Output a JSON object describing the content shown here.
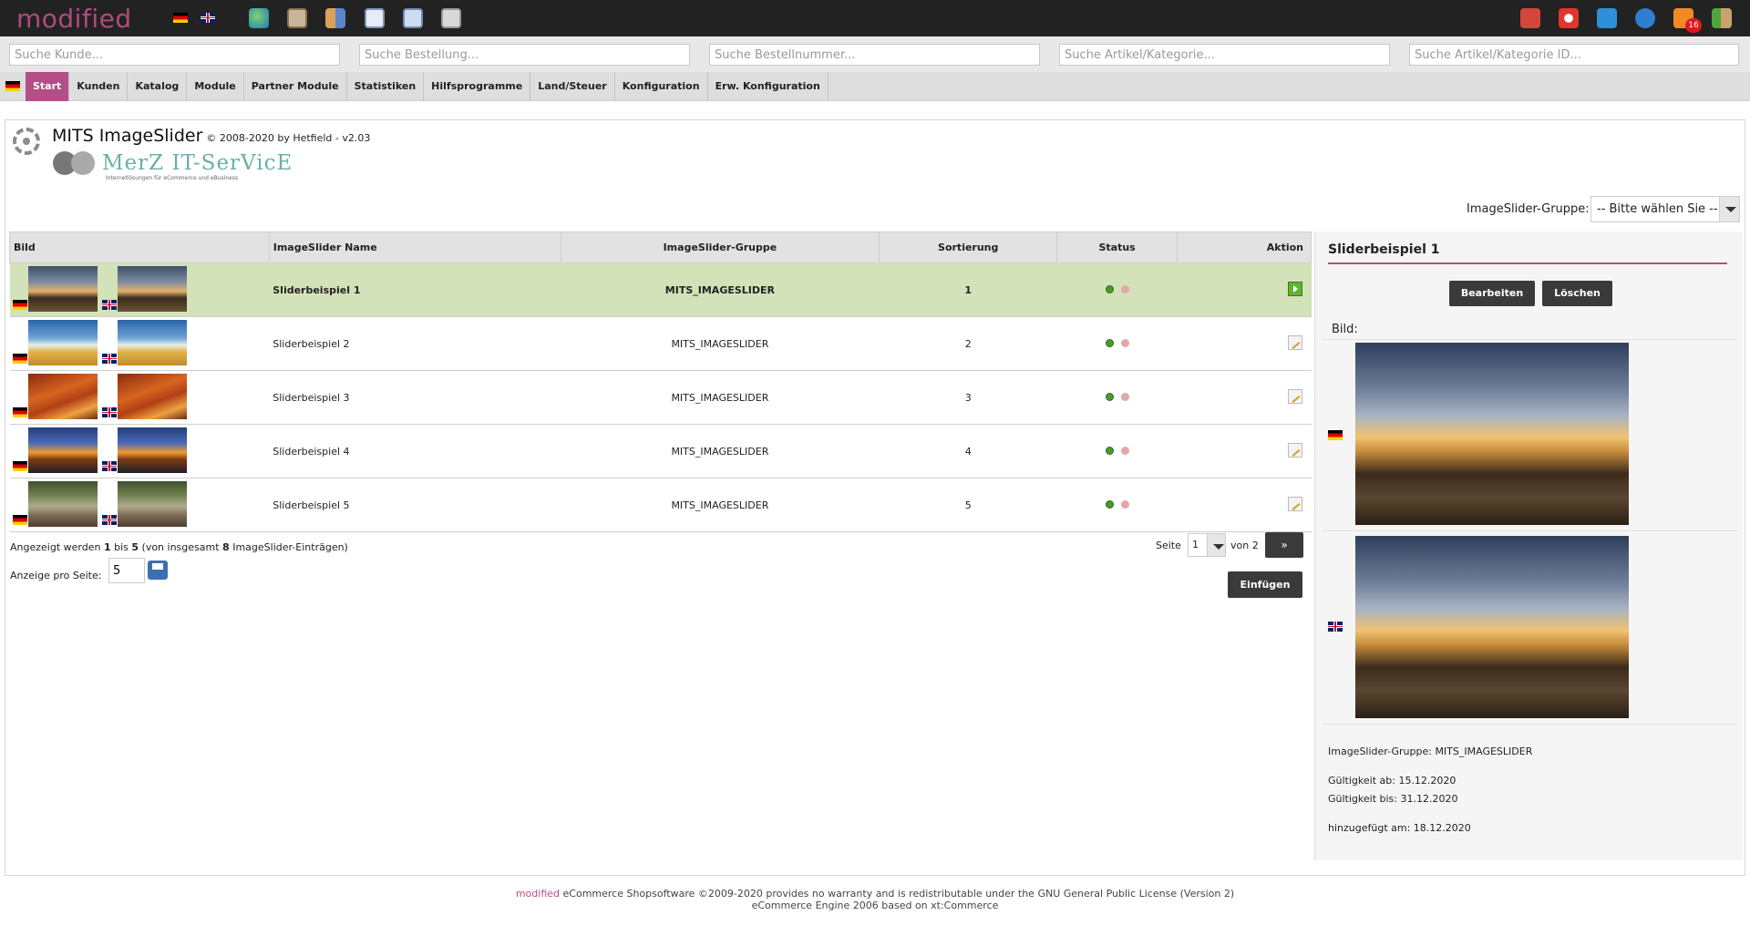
{
  "header": {
    "logo": "modified",
    "icons": [
      "globe-icon",
      "box-icon",
      "users-icon",
      "form-icon",
      "copy-icon",
      "database-icon"
    ],
    "right_icons": [
      "calendar-icon",
      "lifebuoy-icon",
      "refresh-icon",
      "info-icon",
      "rss-icon",
      "logout-icon"
    ],
    "rss_badge": "16"
  },
  "search": {
    "customer": "Suche Kunde...",
    "order": "Suche Bestellung...",
    "order_number": "Suche Bestellnummer...",
    "article": "Suche Artikel/Kategorie...",
    "article_id": "Suche Artikel/Kategorie ID..."
  },
  "nav": [
    "Start",
    "Kunden",
    "Katalog",
    "Module",
    "Partner Module",
    "Statistiken",
    "Hilfsprogramme",
    "Land/Steuer",
    "Konfiguration",
    "Erw. Konfiguration"
  ],
  "page": {
    "title": "MITS ImageSlider",
    "subtitle": "© 2008-2020 by Hetfield - v2.03",
    "company": "MerZ IT-SerVicE",
    "company_tag": "Internetlösungen für eCommerce und eBusiness"
  },
  "group_filter": {
    "label": "ImageSlider-Gruppe:",
    "value": "-- Bitte wählen Sie --"
  },
  "table": {
    "headers": [
      "Bild",
      "ImageSlider Name",
      "ImageSlider-Gruppe",
      "Sortierung",
      "Status",
      "Aktion"
    ],
    "rows": [
      {
        "name": "Sliderbeispiel 1",
        "group": "MITS_IMAGESLIDER",
        "sort": "1",
        "status": "active",
        "selected": true
      },
      {
        "name": "Sliderbeispiel 2",
        "group": "MITS_IMAGESLIDER",
        "sort": "2",
        "status": "active",
        "selected": false
      },
      {
        "name": "Sliderbeispiel 3",
        "group": "MITS_IMAGESLIDER",
        "sort": "3",
        "status": "active",
        "selected": false
      },
      {
        "name": "Sliderbeispiel 4",
        "group": "MITS_IMAGESLIDER",
        "sort": "4",
        "status": "active",
        "selected": false
      },
      {
        "name": "Sliderbeispiel 5",
        "group": "MITS_IMAGESLIDER",
        "sort": "5",
        "status": "active",
        "selected": false
      }
    ]
  },
  "paging": {
    "shown_prefix": "Angezeigt werden ",
    "from": "1",
    "mid": " bis ",
    "to": "5",
    "suffix": " (von insgesamt ",
    "total": "8",
    "suffix2": " ImageSlider-Einträgen)",
    "page_label": "Seite",
    "page_value": "1",
    "of": "von 2",
    "next": "»",
    "per_page_label": "Anzeige pro Seite:",
    "per_page": "5",
    "insert": "Einfügen"
  },
  "panel": {
    "title": "Sliderbeispiel 1",
    "edit": "Bearbeiten",
    "delete": "Löschen",
    "image_label": "Bild:",
    "group_info": "ImageSlider-Gruppe: MITS_IMAGESLIDER",
    "valid_from": "Gültigkeit ab: 15.12.2020",
    "valid_to": "Gültigkeit bis: 31.12.2020",
    "added": "hinzugefügt am: 18.12.2020"
  },
  "footer": {
    "brand": "modified",
    "line1": " eCommerce Shopsoftware ©2009-2020 provides no warranty and is redistributable under the GNU General Public License (Version 2)",
    "line2": "eCommerce Engine 2006 based on xt:Commerce"
  },
  "colors": {
    "accent": "#b34f86",
    "topbar": "#222222",
    "selected_row": "#d3e2b8"
  }
}
